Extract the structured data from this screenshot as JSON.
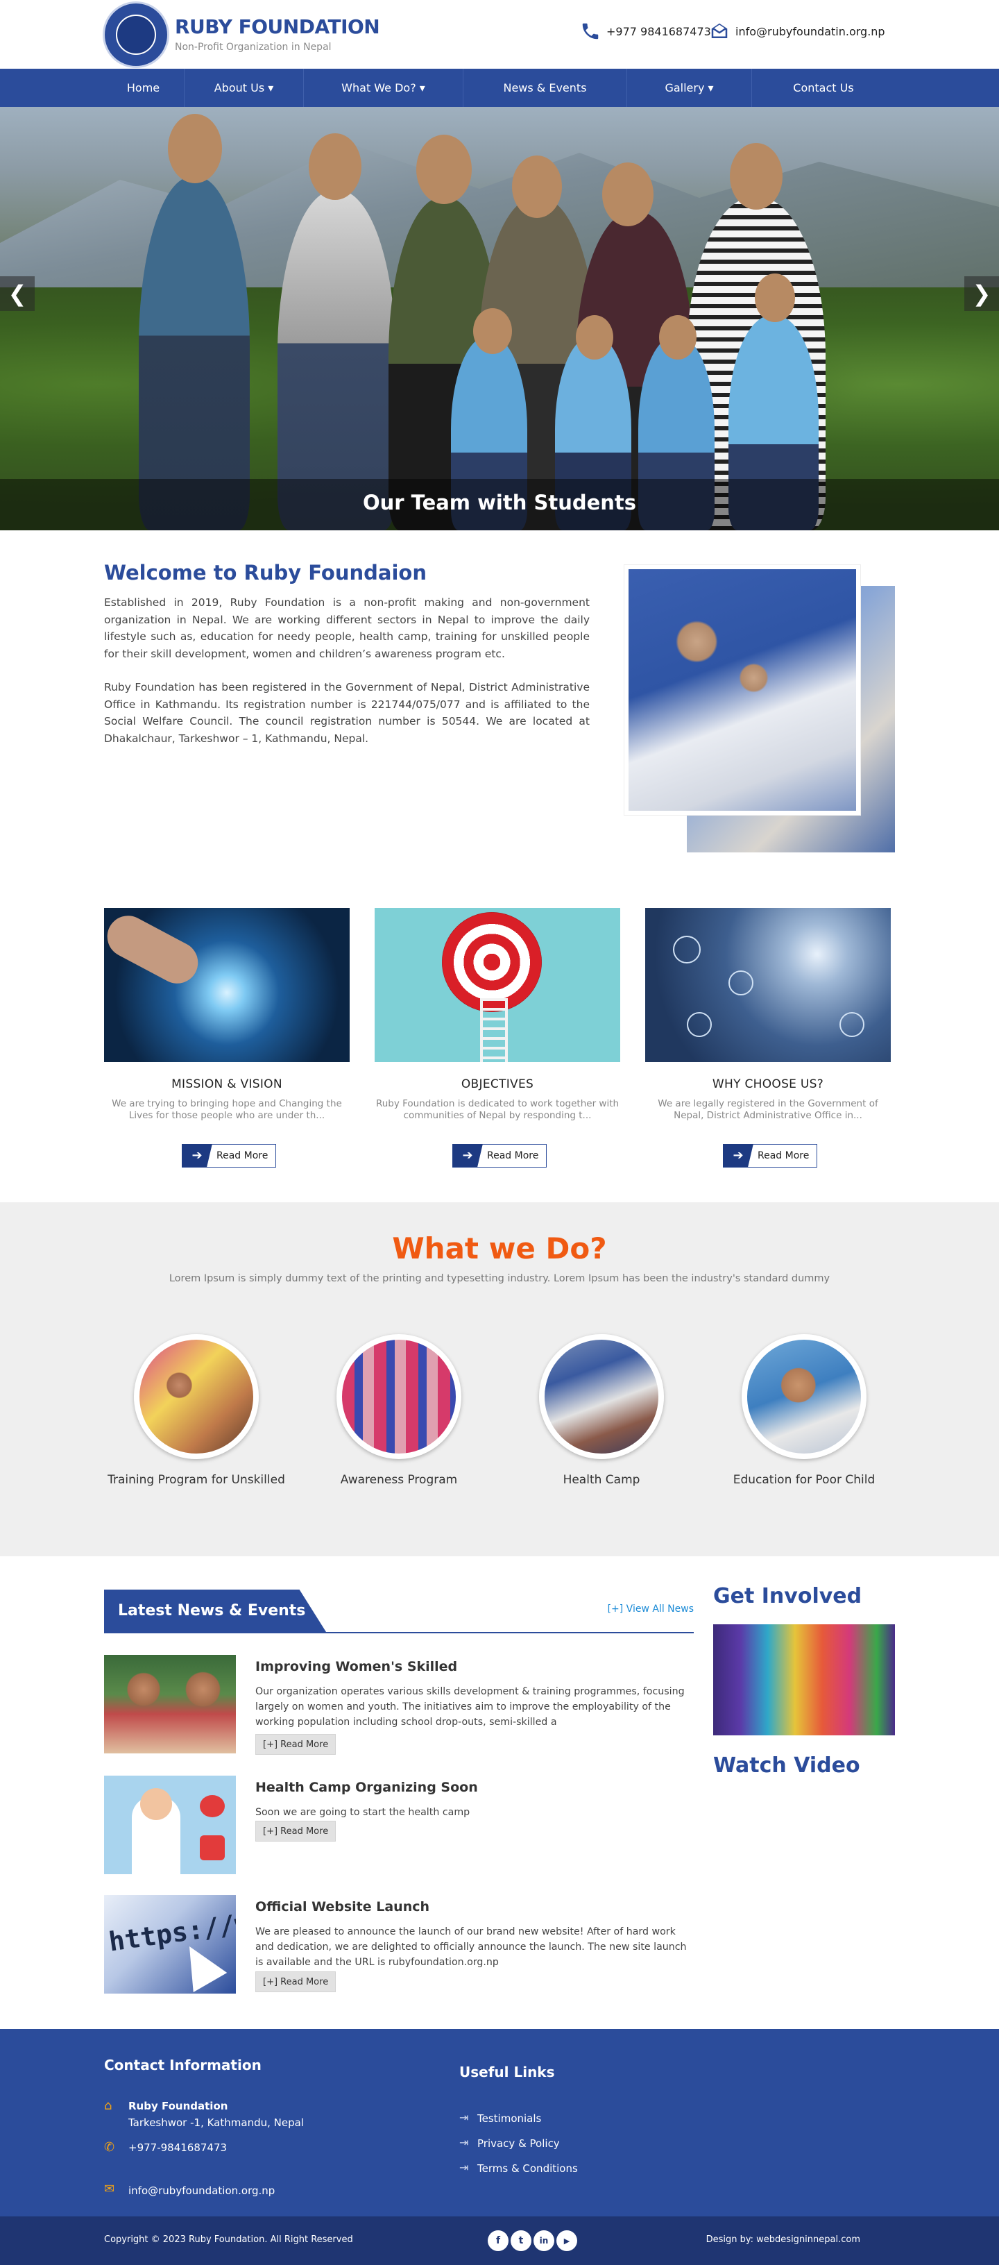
{
  "header": {
    "logo_title": "RUBY FOUNDATION",
    "logo_subtitle": "Non-Profit Organization in Nepal",
    "phone": "+977 9841687473",
    "email": "info@rubyfoundatin.org.np",
    "phone_icon": "phone-icon",
    "email_icon": "email-icon"
  },
  "nav": {
    "items": [
      {
        "label": "Home"
      },
      {
        "label": "About Us ▾"
      },
      {
        "label": "What We Do? ▾"
      },
      {
        "label": "News & Events"
      },
      {
        "label": "Gallery ▾"
      },
      {
        "label": "Contact Us"
      }
    ]
  },
  "hero": {
    "caption": "Our Team with Students",
    "prev": "❮",
    "next": "❯"
  },
  "welcome": {
    "title": "Welcome to Ruby Foundaion",
    "p1": "Established in 2019, Ruby Foundation is a non-profit making and non-government organization in Nepal. We are working different sectors in Nepal to improve the daily lifestyle such as, education for needy people, health camp, training for unskilled people for their skill development, women and children’s awareness program etc.",
    "p2": "Ruby Foundation has been registered in the Government of Nepal, District Administrative Office in Kathmandu. Its registration number is 221744/075/077 and is affiliated to the Social Welfare Council. The council registration number is 50544. We are located at Dhakalchaur, Tarkeshwor – 1, Kathmandu, Nepal."
  },
  "cards": [
    {
      "title": "MISSION & VISION",
      "desc": "We are trying to bringing hope and Changing the Lives for those people who are under th...",
      "button": "Read More"
    },
    {
      "title": "OBJECTIVES",
      "desc": "Ruby Foundation is dedicated to work together with communities of Nepal by responding t...",
      "button": "Read More"
    },
    {
      "title": "WHY CHOOSE US?",
      "desc": "We are legally registered in the Government of Nepal, District Administrative Office in...",
      "button": "Read More"
    }
  ],
  "what_we_do": {
    "title": "What we Do?",
    "subtitle": "Lorem Ipsum is simply dummy text of the printing and typesetting industry. Lorem Ipsum has been the industry's standard dummy",
    "items": [
      {
        "label": "Training Program for Unskilled"
      },
      {
        "label": "Awareness Program"
      },
      {
        "label": "Health Camp"
      },
      {
        "label": "Education for Poor Child"
      }
    ]
  },
  "news": {
    "heading": "Latest News & Events",
    "view_all": "[+] View All News",
    "items": [
      {
        "title": "Improving Women's Skilled",
        "text": "Our organization operates various skills development & training programmes, focusing largely on women and youth. The initiatives aim to improve the employability of the working population including school drop-outs, semi-skilled a",
        "button": "[+] Read More"
      },
      {
        "title": "Health Camp Organizing Soon",
        "text": "Soon we are going to start the health camp",
        "button": "[+] Read More"
      },
      {
        "title": "Official Website Launch",
        "text": "We are pleased to announce the launch of our brand new website! After of hard work and dedication, we are delighted to officially announce the launch. The new site launch is available and the URL is rubyfoundation.org.np",
        "button": "[+] Read More"
      }
    ],
    "thumb_text": "https://ww"
  },
  "sidebar": {
    "get_involved": "Get Involved",
    "watch_video": "Watch Video"
  },
  "footer": {
    "contact_heading": "Contact Information",
    "org_name": "Ruby Foundation",
    "address": "Tarkeshwor -1, Kathmandu, Nepal",
    "phone": "+977-9841687473",
    "email": "info@rubyfoundation.org.np",
    "links_heading": "Useful Links",
    "links": [
      {
        "label": "Testimonials"
      },
      {
        "label": "Privacy & Policy"
      },
      {
        "label": "Terms & Conditions"
      }
    ],
    "copyright": "Copyright © 2023 Ruby Foundation. All Right Reserved",
    "design_by": "Design by: webdesigninnepal.com",
    "social": [
      {
        "icon": "facebook-icon",
        "glyph": "f"
      },
      {
        "icon": "twitter-icon",
        "glyph": "t"
      },
      {
        "icon": "linkedin-icon",
        "glyph": "in"
      },
      {
        "icon": "youtube-icon",
        "glyph": "▶"
      }
    ]
  },
  "colors": {
    "brand_blue": "#2b4c9b",
    "accent_orange": "#f05a12",
    "footer_dark": "#1f3572"
  }
}
